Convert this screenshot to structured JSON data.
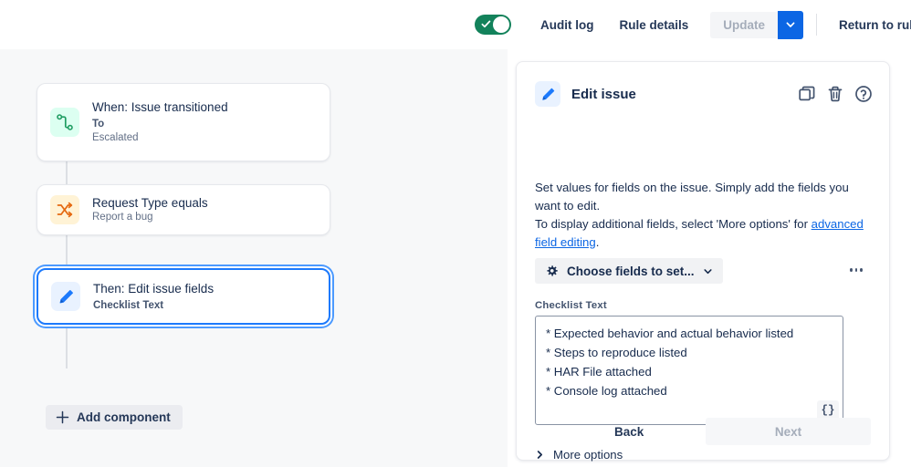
{
  "topbar": {
    "toggle": {
      "name": "rule-enabled-toggle",
      "state": "on",
      "color": "#13825b"
    },
    "audit_log_label": "Audit log",
    "rule_details_label": "Rule details",
    "update_label": "Update",
    "update_caret_icon": "chevron-down-icon",
    "update_caret_color": "#0c66e4",
    "return_label": "Return to rules"
  },
  "canvas": {
    "nodes": [
      {
        "title": "When: Issue transitioned",
        "sub_bold": "To",
        "sub": "Escalated",
        "icon": "transition-path-icon",
        "icon_color": "#1f9d62",
        "icon_bg": "#dcfff1",
        "selected": false
      },
      {
        "title": "Request Type equals",
        "sub_bold": "",
        "sub": "Report a bug",
        "icon": "shuffle-arrows-icon",
        "icon_color": "#e56910",
        "icon_bg": "#fff3d6",
        "selected": false
      },
      {
        "title": "Then: Edit issue fields",
        "sub_bold": "Checklist Text",
        "sub": "",
        "icon": "pencil-icon",
        "icon_color": "#1d7afc",
        "icon_bg": "#e9f2ff",
        "selected": true
      }
    ],
    "add_component_label": "Add component",
    "add_component_icon": "plus-icon"
  },
  "panel": {
    "badge_icon": "pencil-icon",
    "title": "Edit issue",
    "actions": [
      {
        "name": "duplicate-icon",
        "label": "Duplicate"
      },
      {
        "name": "trash-icon",
        "label": "Delete"
      },
      {
        "name": "help-circle-icon",
        "label": "Help"
      }
    ],
    "description_part1": "Set values for fields on the issue. Simply add the fields you want to edit.",
    "description_part2": "To display additional fields, select 'More options' for ",
    "description_link": "advanced field editing",
    "description_part3": ".",
    "choose_fields_label": "Choose fields to set...",
    "choose_fields_icon": "gear-icon",
    "choose_fields_caret": "chevron-down-icon",
    "field_label": "Checklist Text",
    "field_value": "* Expected behavior and actual behavior listed\n* Steps to reproduce listed\n* HAR File attached\n* Console log attached",
    "field_placeholder": "",
    "smart_value_button": "{}",
    "overflow_menu_icon": "more-horizontal-icon",
    "more_options_label": "More options",
    "more_options_icon": "chevron-right-icon",
    "back_label": "Back",
    "next_label": "Next"
  },
  "colors": {
    "accent": "#0c66e4",
    "selected_border": "#1d7afc",
    "canvas_bg": "#f7f8f9",
    "text": "#172b4d",
    "muted": "#626f86",
    "toggle_on": "#13825b"
  }
}
